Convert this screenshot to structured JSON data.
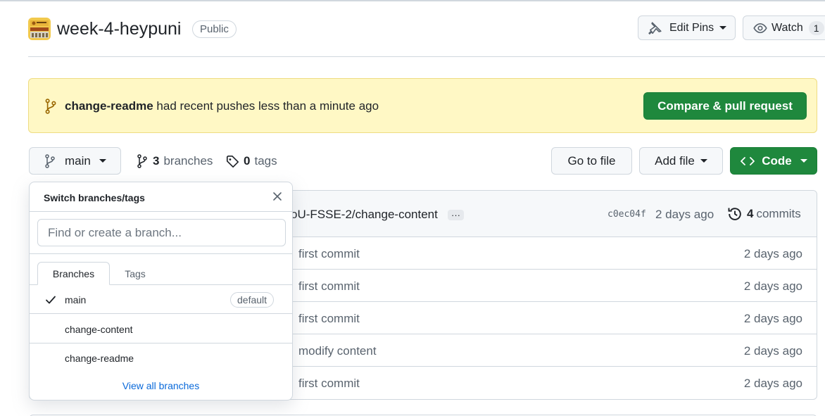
{
  "repo": {
    "name": "week-4-heypuni",
    "visibility": "Public"
  },
  "header_actions": {
    "edit_pins": "Edit Pins",
    "watch": "Watch",
    "watch_count": "1"
  },
  "banner": {
    "branch": "change-readme",
    "message": "had recent pushes less than a minute ago",
    "button": "Compare & pull request"
  },
  "branch_bar": {
    "current_branch": "main",
    "branches_count": "3",
    "branches_label": "branches",
    "tags_count": "0",
    "tags_label": "tags",
    "go_to_file": "Go to file",
    "add_file": "Add file",
    "code": "Code"
  },
  "latest_commit": {
    "message": "oU-FSSE-2/change-content",
    "ellipsis": "···",
    "sha": "c0ec04f",
    "age": "2 days ago",
    "commits_count": "4",
    "commits_label": "commits"
  },
  "file_rows": [
    {
      "message": "first commit",
      "age": "2 days ago"
    },
    {
      "message": "first commit",
      "age": "2 days ago"
    },
    {
      "message": "first commit",
      "age": "2 days ago"
    },
    {
      "message": "modify content",
      "age": "2 days ago"
    },
    {
      "message": "first commit",
      "age": "2 days ago"
    }
  ],
  "branch_dropdown": {
    "title": "Switch branches/tags",
    "input_placeholder": "Find or create a branch...",
    "tabs": [
      "Branches",
      "Tags"
    ],
    "items": [
      {
        "name": "main",
        "selected": true,
        "badge": "default"
      },
      {
        "name": "change-content"
      },
      {
        "name": "change-readme"
      }
    ],
    "view_all": "View all branches"
  },
  "colors": {
    "primary_green": "#1f883d",
    "banner_bg": "#fff8c5",
    "link_blue": "#0969da"
  },
  "icons": [
    "repo-avatar",
    "pin-icon",
    "eye-icon",
    "git-branch-icon",
    "tag-icon",
    "code-icon",
    "history-icon",
    "close-icon",
    "check-icon"
  ]
}
